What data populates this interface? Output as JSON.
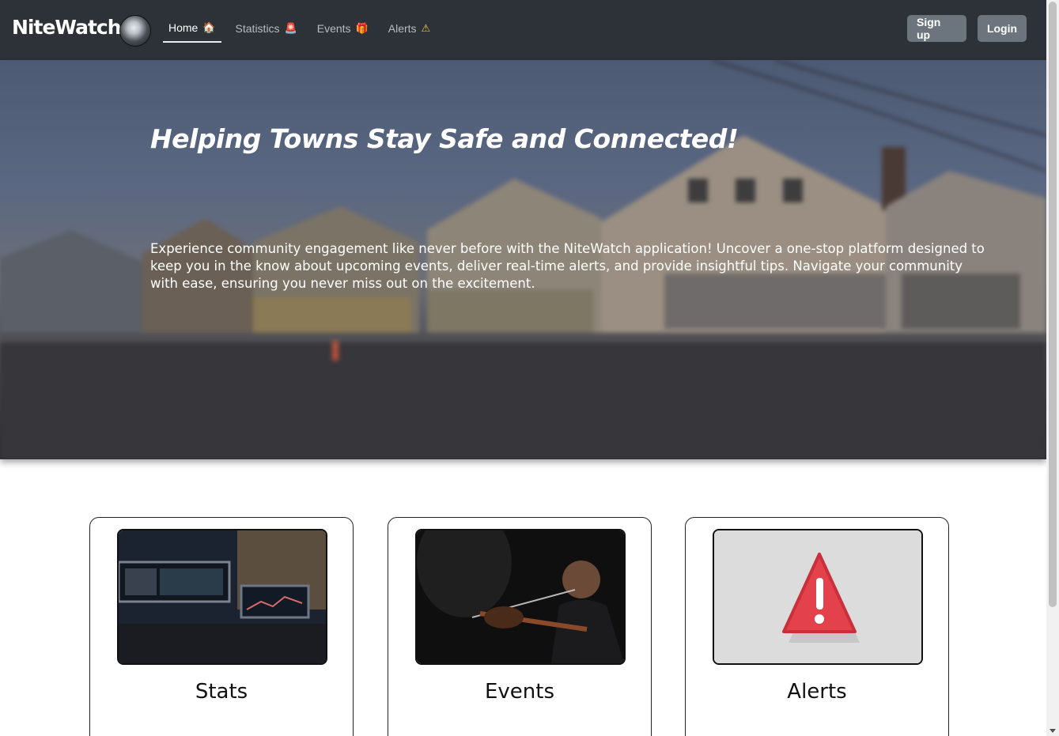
{
  "navbar": {
    "brand": "NiteWatch",
    "links": [
      {
        "label": "Home",
        "emoji": "🏠",
        "active": true
      },
      {
        "label": "Statistics",
        "emoji": "🚨",
        "active": false
      },
      {
        "label": "Events",
        "emoji": "🎁",
        "active": false
      },
      {
        "label": "Alerts",
        "emoji": "⚠",
        "active": false
      }
    ],
    "signup_label": "Sign up",
    "login_label": "Login"
  },
  "hero": {
    "title": "Helping Towns Stay Safe and Connected!",
    "text": "Experience community engagement like never before with the NiteWatch application! Uncover a one-stop platform designed to keep you in the know about upcoming events, deliver real-time alerts, and provide insightful tips. Navigate your community with ease, ensuring you never miss out on the excitement."
  },
  "cards": [
    {
      "title": "Stats",
      "image": "monitors-photo"
    },
    {
      "title": "Events",
      "image": "guitarist-photo"
    },
    {
      "title": "Alerts",
      "image": "warning-sign-photo"
    }
  ],
  "colors": {
    "navbar_bg": "#2c3237",
    "button_bg": "#6c757d",
    "text_light": "#ffffff"
  }
}
